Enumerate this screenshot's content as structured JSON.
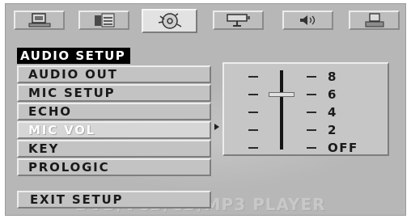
{
  "tabs": [
    {
      "icon": "monitor-icon",
      "active": false
    },
    {
      "icon": "speaker-settings-icon",
      "active": false
    },
    {
      "icon": "audio-disc-icon",
      "active": true
    },
    {
      "icon": "projector-icon",
      "active": false
    },
    {
      "icon": "volume-icon",
      "active": false
    },
    {
      "icon": "computer-icon",
      "active": false
    }
  ],
  "page_title": "AUDIO SETUP",
  "menu": {
    "items": [
      {
        "label": "AUDIO OUT",
        "selected": false
      },
      {
        "label": "MIC SETUP",
        "selected": false
      },
      {
        "label": "ECHO",
        "selected": false
      },
      {
        "label": "MIC VOL",
        "selected": true
      },
      {
        "label": "KEY",
        "selected": false
      },
      {
        "label": "PROLOGIC",
        "selected": false
      }
    ],
    "exit_label": "EXIT SETUP"
  },
  "mic_volume": {
    "levels": [
      "8",
      "6",
      "4",
      "2",
      "OFF"
    ],
    "current": "6"
  },
  "watermark": "DVD/VCD/CD/MP3 PLAYER",
  "colors": {
    "background": "#b7b7b7",
    "title_bg": "#000000",
    "title_text": "#ffffff",
    "selected_text": "#ffffff",
    "item_text": "#1a1a1a"
  }
}
